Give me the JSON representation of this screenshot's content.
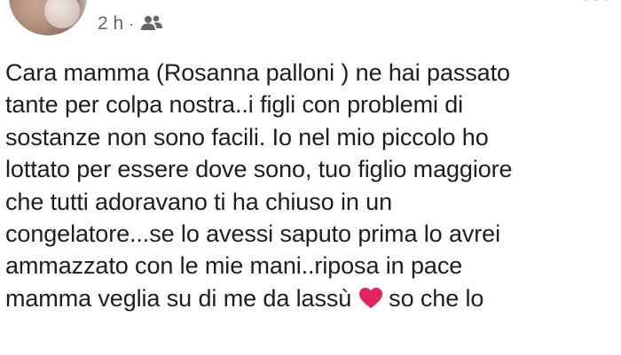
{
  "post": {
    "timestamp": "2 h",
    "separator": "·",
    "audience_icon": "friends-icon",
    "text_lines": [
      "Cara mamma (Rosanna palloni ) ne hai passato",
      "tante per colpa nostra..i figli con problemi di",
      "sostanze non sono facili. Io nel mio piccolo ho",
      "lottato per essere dove sono, tuo figlio maggiore",
      "che tutti adoravano ti ha chiuso in un",
      "congelatore...se lo avessi saputo prima lo avrei",
      "ammazzato con le mie mani..riposa in pace"
    ],
    "last_line_before_emoji": "mamma veglia su di me da lassù",
    "emoji": "heart-icon",
    "last_line_after_emoji": "so che lo"
  },
  "colors": {
    "text": "#1c1e21",
    "meta": "#65676b",
    "heart": "#e0245e"
  }
}
